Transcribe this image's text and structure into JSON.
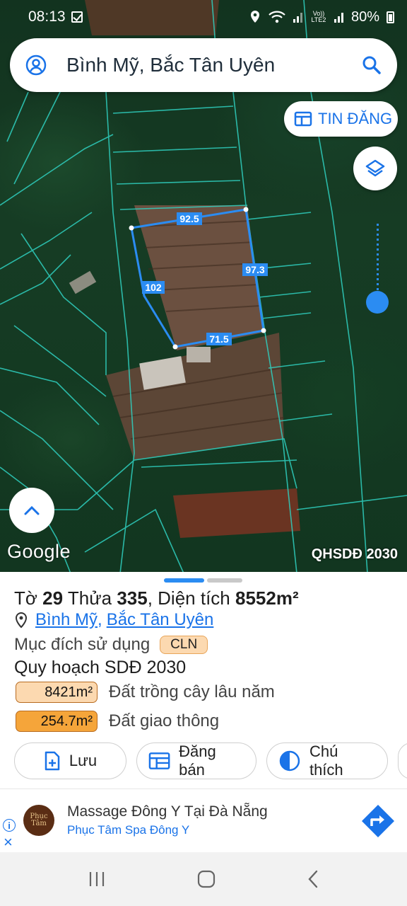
{
  "status_bar": {
    "time": "08:13",
    "network_label": "Vo)) LTE2",
    "battery": "80%"
  },
  "search": {
    "title": "Bình Mỹ, Bắc Tân Uyên"
  },
  "map": {
    "post_button_label": "TIN ĐĂNG",
    "google_label": "Google",
    "layer_label": "QHSDĐ 2030",
    "edge_labels": {
      "top": "92.5",
      "left": "102",
      "right": "97.3",
      "bottom": "71.5"
    }
  },
  "parcel": {
    "title_prefix": "Tờ",
    "sheet_no": "29",
    "plot_word": "Thửa",
    "plot_no": "335",
    "area_word": ", Diện tích",
    "area_value": "8552m²",
    "address_commune": "Bình Mỹ",
    "address_sep": ",",
    "address_district": "Bắc Tân Uyên",
    "purpose_label": "Mục đích sử dụng",
    "purpose_code": "CLN",
    "plan_title": "Quy hoạch SDĐ 2030",
    "land_uses": [
      {
        "value": "8421m²",
        "name": "Đất trồng cây lâu năm",
        "color": "#fcd9b0"
      },
      {
        "value": "254.7m²",
        "name": "Đất giao thông",
        "color": "#f5a53a"
      }
    ]
  },
  "actions": [
    {
      "label": "Lưu",
      "icon": "add-file-icon"
    },
    {
      "label": "Đăng bán",
      "icon": "calendar-icon"
    },
    {
      "label": "Chú thích",
      "icon": "half-circle-icon"
    }
  ],
  "ad": {
    "logo_text": "Phục Tâm",
    "title": "Massage Đông Y Tại Đà Nẵng",
    "subtitle": "Phục Tâm Spa Đông Y",
    "info_glyph": "i",
    "close_glyph": "×"
  },
  "colors": {
    "accent": "#1a73e8",
    "boundary": "#2b8cf2",
    "parcel_lines": "#2fd0c0"
  }
}
